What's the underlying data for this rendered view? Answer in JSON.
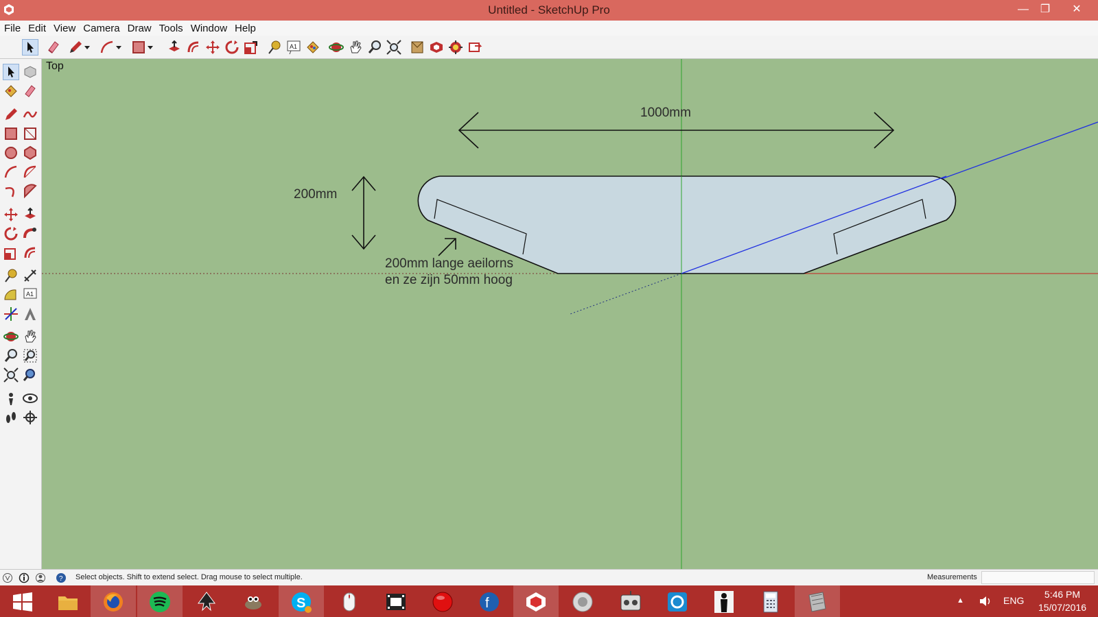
{
  "window": {
    "title": "Untitled - SketchUp Pro",
    "minimize_glyph": "—",
    "restore_glyph": "❐",
    "close_glyph": "✕"
  },
  "menu": [
    "File",
    "Edit",
    "View",
    "Camera",
    "Draw",
    "Tools",
    "Window",
    "Help"
  ],
  "toolbar": {
    "tools": [
      "select-icon",
      "eraser-icon",
      "pencil-icon",
      "arc-icon",
      "rectangle-icon",
      "push-pull-icon",
      "offset-icon",
      "move-icon",
      "rotate-icon",
      "scale-icon",
      "tape-measure-icon",
      "text-icon",
      "paint-bucket-icon",
      "orbit-icon",
      "pan-icon",
      "zoom-icon",
      "zoom-extents-icon",
      "warehouse-icon",
      "extension-icon",
      "component-icon",
      "send-icon"
    ]
  },
  "palette": {
    "tools": [
      "select-icon",
      "component-icon",
      "paint-bucket-icon",
      "eraser-icon",
      "line-icon",
      "freehand-icon",
      "rectangle-icon",
      "rotated-rectangle-icon",
      "circle-icon",
      "polygon-icon",
      "arc-icon",
      "two-point-arc-icon",
      "three-point-arc-icon",
      "pie-icon",
      "move-icon",
      "push-pull-icon",
      "rotate-icon",
      "follow-me-icon",
      "scale-icon",
      "offset-icon",
      "tape-measure-icon",
      "dimension-icon",
      "protractor-icon",
      "text-icon",
      "axes-icon",
      "3d-text-icon",
      "orbit-icon",
      "pan-icon",
      "zoom-icon",
      "zoom-window-icon",
      "zoom-extents-icon",
      "previous-view-icon",
      "position-camera-icon",
      "look-around-icon",
      "walk-icon",
      "section-plane-icon"
    ]
  },
  "viewport": {
    "view_name": "Top",
    "dimension_width": "1000mm",
    "dimension_height": "200mm",
    "note_line1": "200mm lange aeilorns",
    "note_line2": "en ze zijn 50mm hoog"
  },
  "statusbar": {
    "message": "Select objects. Shift to extend select. Drag mouse to select multiple.",
    "measurements_label": "Measurements",
    "measurements_value": ""
  },
  "taskbar": {
    "apps": [
      "start-icon",
      "file-explorer-icon",
      "firefox-icon",
      "spotify-icon",
      "inkscape-icon",
      "gimp-icon",
      "skype-icon",
      "mouse-icon",
      "video-editor-icon",
      "record-icon",
      "filezilla-icon",
      "sketchup-icon",
      "speaker-app-icon",
      "rc-transmitter-icon",
      "media-icon",
      "person-icon",
      "calculator-icon",
      "files-icon"
    ],
    "language": "ENG",
    "time": "5:46 PM",
    "date": "15/07/2016"
  },
  "colors": {
    "titlebar": "#d9685e",
    "viewport": "#9cbc8c",
    "wing_fill": "#c8d8e0",
    "axis_green": "#2ea52e",
    "axis_blue": "#2030e0",
    "axis_red": "#c82020",
    "taskbar": "#ad2e2a"
  }
}
